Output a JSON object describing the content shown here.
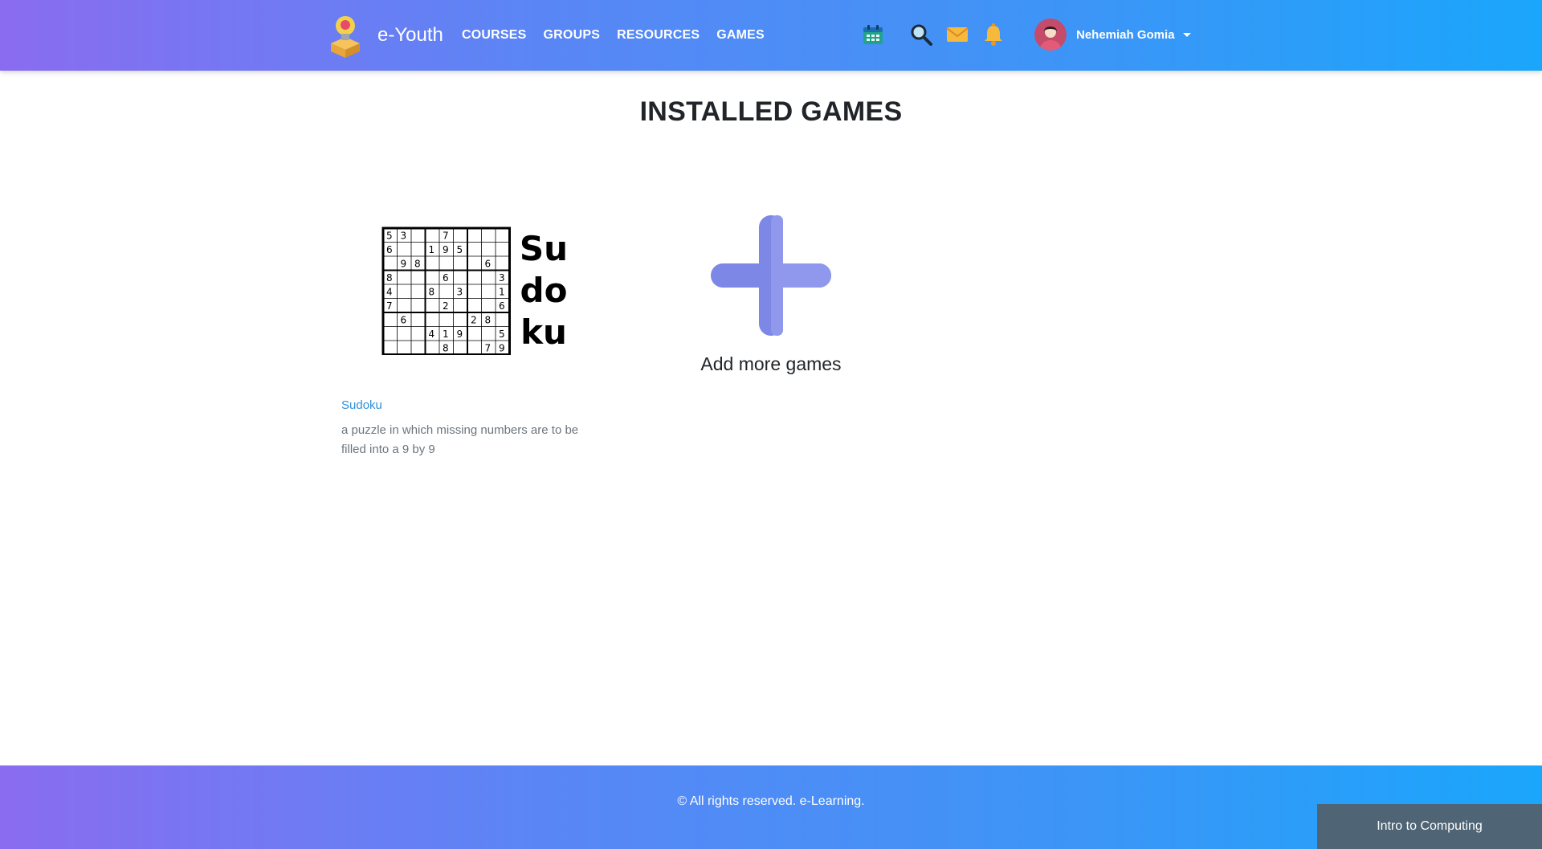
{
  "brand": {
    "name": "e-Youth",
    "logo_icon": "lightbulb-box-logo"
  },
  "nav": {
    "links": [
      "COURSES",
      "GROUPS",
      "RESOURCES",
      "GAMES"
    ]
  },
  "header_icons": [
    "calendar-icon",
    "search-icon",
    "mail-icon",
    "bell-icon"
  ],
  "user": {
    "name": "Nehemiah Gomia"
  },
  "main": {
    "title": "INSTALLED GAMES",
    "games": [
      {
        "name": "Sudoku",
        "description": "a puzzle in which missing numbers are to be filled into a 9 by 9",
        "thumb_text": [
          "Su",
          "do",
          "ku"
        ],
        "grid": [
          [
            "5",
            "3",
            "",
            "",
            "7",
            "",
            "",
            "",
            ""
          ],
          [
            "6",
            "",
            "",
            "1",
            "9",
            "5",
            "",
            "",
            ""
          ],
          [
            "",
            "9",
            "8",
            "",
            "",
            "",
            "",
            "6",
            ""
          ],
          [
            "8",
            "",
            "",
            "",
            "6",
            "",
            "",
            "",
            "3"
          ],
          [
            "4",
            "",
            "",
            "8",
            "",
            "3",
            "",
            "",
            "1"
          ],
          [
            "7",
            "",
            "",
            "",
            "2",
            "",
            "",
            "",
            "6"
          ],
          [
            "",
            "6",
            "",
            "",
            "",
            "",
            "2",
            "8",
            ""
          ],
          [
            "",
            "",
            "",
            "4",
            "1",
            "9",
            "",
            "",
            "5"
          ],
          [
            "",
            "",
            "",
            "",
            "8",
            "",
            "",
            "7",
            "9"
          ]
        ]
      }
    ],
    "add_label": "Add more games"
  },
  "footer": {
    "copyright": "© All rights reserved. e-Learning."
  },
  "course_tab": "Intro to Computing",
  "colors": {
    "accent_purple": "#8a6cf0",
    "accent_blue": "#1aa6fb",
    "link": "#2f8fd8",
    "plus": "#7b86e6"
  }
}
